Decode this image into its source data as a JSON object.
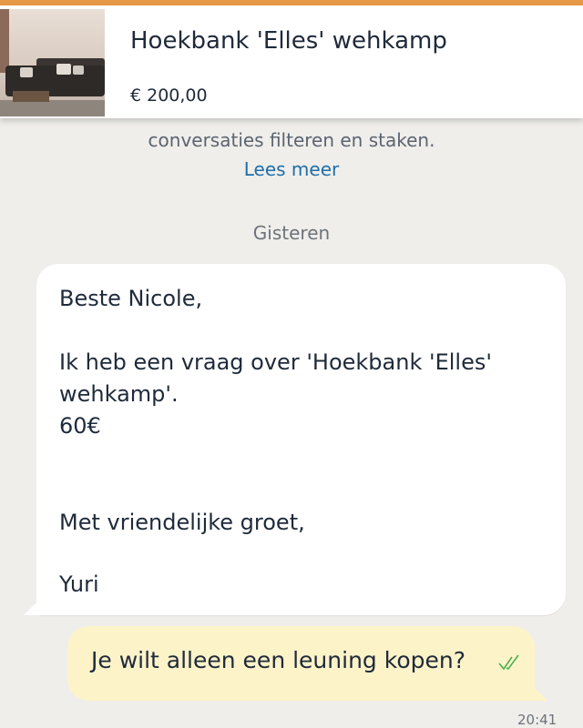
{
  "listing": {
    "title": "Hoekbank 'Elles' wehkamp",
    "price": "€ 200,00"
  },
  "notice": {
    "text": "conversaties filteren en staken.",
    "read_more": "Lees meer"
  },
  "date_separator": "Gisteren",
  "incoming_message": {
    "lines": [
      "Beste Nicole,",
      "Ik heb een vraag over 'Hoekbank 'Elles'",
      "wehkamp'.",
      "60€",
      "Met vriendelijke groet,",
      "Yuri"
    ]
  },
  "outgoing_message": {
    "text": "Je wilt alleen een leuning kopen?",
    "status_icon": "double-check-icon",
    "time": "20:41"
  },
  "colors": {
    "accent": "#e79a46",
    "link": "#1f6ea8",
    "outgoing_bubble": "#fdf3c9",
    "check": "#4caf50"
  }
}
